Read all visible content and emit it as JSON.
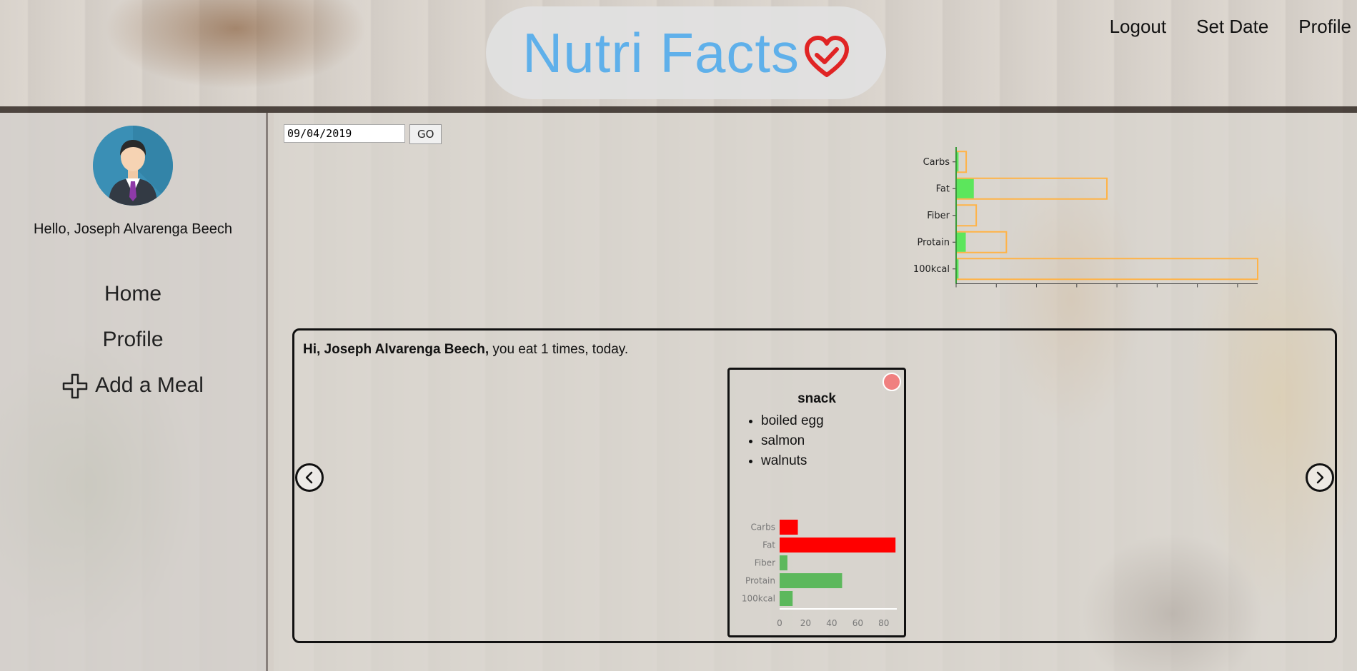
{
  "brand": {
    "name": "Nutri Facts"
  },
  "top_nav": [
    {
      "label": "Logout"
    },
    {
      "label": "Set Date"
    },
    {
      "label": "Profile"
    }
  ],
  "sidebar": {
    "greeting": "Hello, Joseph Alvarenga Beech",
    "items": [
      {
        "label": "Home"
      },
      {
        "label": "Profile"
      },
      {
        "label": "Add a Meal",
        "icon": "plus-icon"
      }
    ]
  },
  "date_picker": {
    "value": "09/04/2019",
    "go_label": "GO"
  },
  "daily_chart": {
    "chart_data": {
      "type": "bar",
      "orientation": "horizontal",
      "categories": [
        "Carbs",
        "Fat",
        "Fiber",
        "Protain",
        "100kcal"
      ],
      "series": [
        {
          "values": [
            12,
            88,
            4,
            48,
            12
          ],
          "color": "#ff6b6b"
        },
        {
          "values": [
            50,
            750,
            100,
            250,
            1500
          ],
          "color": "#ffb347"
        }
      ],
      "xlim": [
        0,
        1500
      ],
      "xticks": [
        "0",
        "200",
        "400",
        "600",
        "800",
        "1,000",
        "1,200",
        "1,400"
      ],
      "colors": {
        "over_limit": "#ff6b6b",
        "under_limit": "#5ce65c",
        "target": "#ffb347"
      }
    }
  },
  "meals_panel": {
    "greeting_name": "Hi, Joseph Alvarenga Beech,",
    "greeting_rest": " you eat 1 times, today.",
    "meals": [
      {
        "title": "snack",
        "foods": [
          "boiled egg",
          "salmon",
          "walnuts"
        ],
        "chart_data": {
          "type": "bar",
          "orientation": "horizontal",
          "categories": [
            "Carbs",
            "Fat",
            "Fiber",
            "Protain",
            "100kcal"
          ],
          "values": [
            14,
            89,
            6,
            48,
            10
          ],
          "colors": [
            "#ff0000",
            "#ff0000",
            "#5cb85c",
            "#5cb85c",
            "#5cb85c"
          ],
          "xlim": [
            0,
            90
          ],
          "xticks": [
            "0",
            "20",
            "40",
            "60",
            "80"
          ]
        }
      }
    ]
  }
}
